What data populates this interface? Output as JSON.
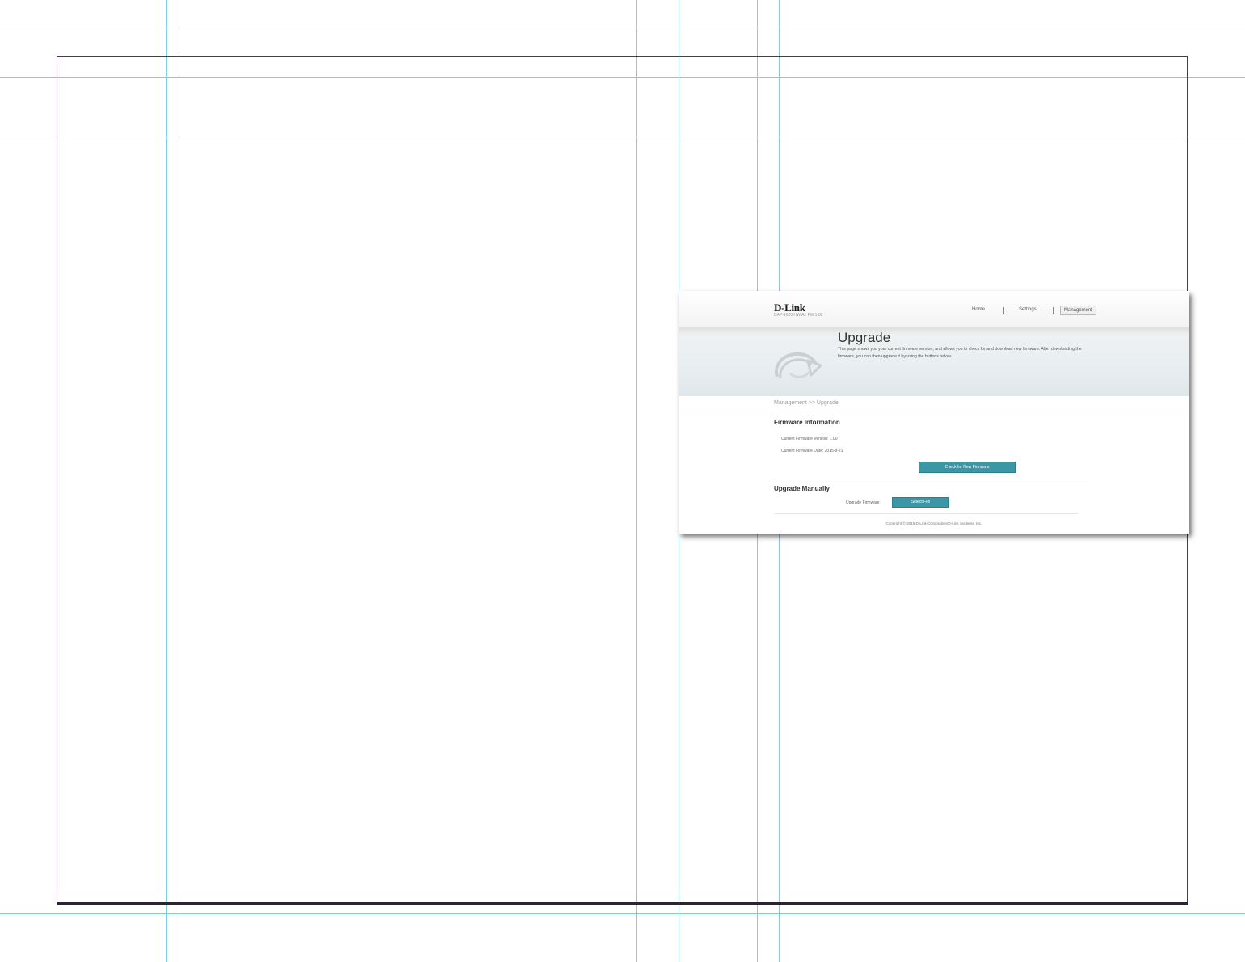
{
  "router_ui": {
    "brand": "D-Link",
    "model": "DAP-1620 HW:A1 FW:1.00",
    "nav": {
      "home": "Home",
      "settings": "Settings",
      "management": "Management"
    },
    "banner": {
      "title": "Upgrade",
      "description": "This page shows you your current firmware version, and allows you to check for and download new firmware. After downloading the firmware, you can then upgrade it by using the buttons below."
    },
    "breadcrumb": "Management >> Upgrade",
    "firmware_info": {
      "title": "Firmware Information",
      "version_line": "Current Firmware Version: 1.00",
      "date_line": "Current Firmware Date: 2015-8-21",
      "check_button": "Check for New Firmware"
    },
    "upgrade_manually": {
      "title": "Upgrade Manually",
      "label": "Upgrade Firmware:",
      "select_button": "Select File"
    },
    "footer": "Copyright © 2015 D-Link Corporation/D-Link Systems, Inc."
  },
  "colors": {
    "guide": "#7fcde0",
    "frame": "#5a2d62",
    "button": "#3b97a6"
  }
}
